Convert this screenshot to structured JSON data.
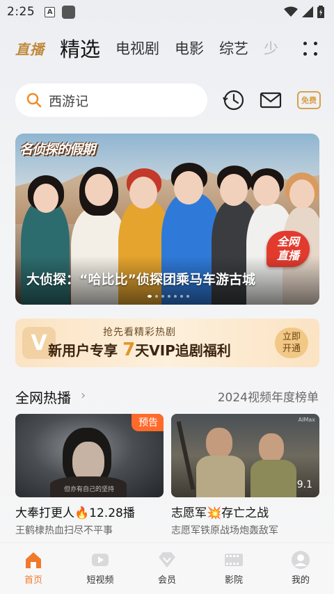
{
  "status": {
    "time": "2:25"
  },
  "tabs": {
    "live": "直播",
    "selected": "精选",
    "items": [
      "电视剧",
      "电影",
      "综艺"
    ],
    "overflow": "少"
  },
  "search": {
    "query": "西游记"
  },
  "header_icons": [
    "history-clock-icon",
    "mail-icon"
  ],
  "vip_badge": "免费",
  "banner": {
    "logo_text": "名侦探的假期",
    "caption": "大侦探：“哈比比”侦探团乘马车游古城",
    "badge_line1": "全网",
    "badge_line2": "直播",
    "page_count": 7,
    "active_page": 1
  },
  "promo": {
    "subtitle": "抢先看精彩热剧",
    "main_prefix": "新用户专享",
    "highlight": "7",
    "main_suffix": "天VIP追剧福利",
    "button_line1": "立即",
    "button_line2": "开通"
  },
  "section": {
    "title": "全网热播",
    "link": "2024视频年度榜单"
  },
  "cards": [
    {
      "title": "大奉打更人🔥12.28播",
      "subtitle": "王鹤棣热血扫尽不平事",
      "tag": "预告",
      "overlay_text": "但亦有自己的坚持"
    },
    {
      "title": "志愿军💥存亡之战",
      "subtitle": "志愿军铁原战场炮轰敌军",
      "score": "9.1",
      "overlay_text": "AIMax"
    }
  ],
  "nav": [
    {
      "label": "首页",
      "icon": "home-icon",
      "active": true
    },
    {
      "label": "短视频",
      "icon": "short-video-icon",
      "active": false
    },
    {
      "label": "会员",
      "icon": "vip-diamond-icon",
      "active": false
    },
    {
      "label": "影院",
      "icon": "cinema-icon",
      "active": false
    },
    {
      "label": "我的",
      "icon": "profile-icon",
      "active": false
    }
  ],
  "colors": {
    "accent": "#f07a2b",
    "gold": "#c08a3c",
    "live_badge": "#e23b2e"
  }
}
